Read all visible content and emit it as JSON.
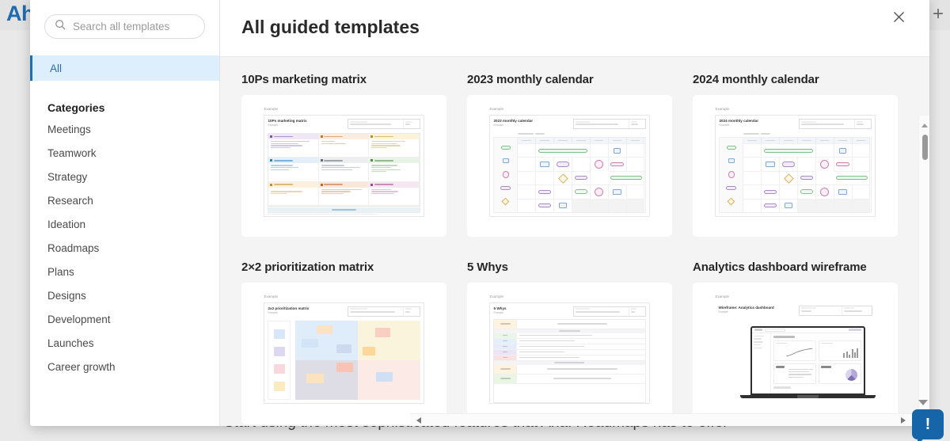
{
  "background": {
    "logo": "Ah",
    "add_button": "+",
    "tagline": "Start using the most sophisticated features that Aha! Roadmaps has to offer"
  },
  "modal": {
    "title": "All guided templates",
    "close_label": "×"
  },
  "sidebar": {
    "search": {
      "placeholder": "Search all templates",
      "value": "",
      "icon": "search-icon"
    },
    "all_label": "All",
    "categories_heading": "Categories",
    "categories": [
      {
        "label": "Meetings"
      },
      {
        "label": "Teamwork"
      },
      {
        "label": "Strategy"
      },
      {
        "label": "Research"
      },
      {
        "label": "Ideation"
      },
      {
        "label": "Roadmaps"
      },
      {
        "label": "Plans"
      },
      {
        "label": "Designs"
      },
      {
        "label": "Development"
      },
      {
        "label": "Launches"
      },
      {
        "label": "Career growth"
      }
    ]
  },
  "templates": [
    {
      "title": "10Ps marketing matrix",
      "thumb": "ps",
      "example_label": "Example",
      "thumb_title": "10Ps marketing matrix"
    },
    {
      "title": "2023 monthly calendar",
      "thumb": "cal",
      "example_label": "Example",
      "thumb_title": "2023 monthly calendar"
    },
    {
      "title": "2024 monthly calendar",
      "thumb": "cal",
      "example_label": "Example",
      "thumb_title": "2024 monthly calendar"
    },
    {
      "title": "2×2 prioritization matrix",
      "thumb": "mx",
      "example_label": "Example",
      "thumb_title": "2x2 prioritization matrix"
    },
    {
      "title": "5 Whys",
      "thumb": "wy",
      "example_label": "Example",
      "thumb_title": "5 Whys"
    },
    {
      "title": "Analytics dashboard wireframe",
      "thumb": "wf",
      "example_label": "Example",
      "thumb_title": "Wireframe: Analytics dashboard"
    }
  ],
  "scrollbars": {
    "vertical_up": "▲",
    "vertical_down": "▼",
    "horizontal_left": "◀",
    "horizontal_right": "▶"
  },
  "help": {
    "label": "!"
  },
  "colors": {
    "accent": "#1a6fb5",
    "selected_bg": "#ddeefc",
    "content_bg": "#f4f4f4",
    "brand_blue": "#1f6bb0"
  }
}
